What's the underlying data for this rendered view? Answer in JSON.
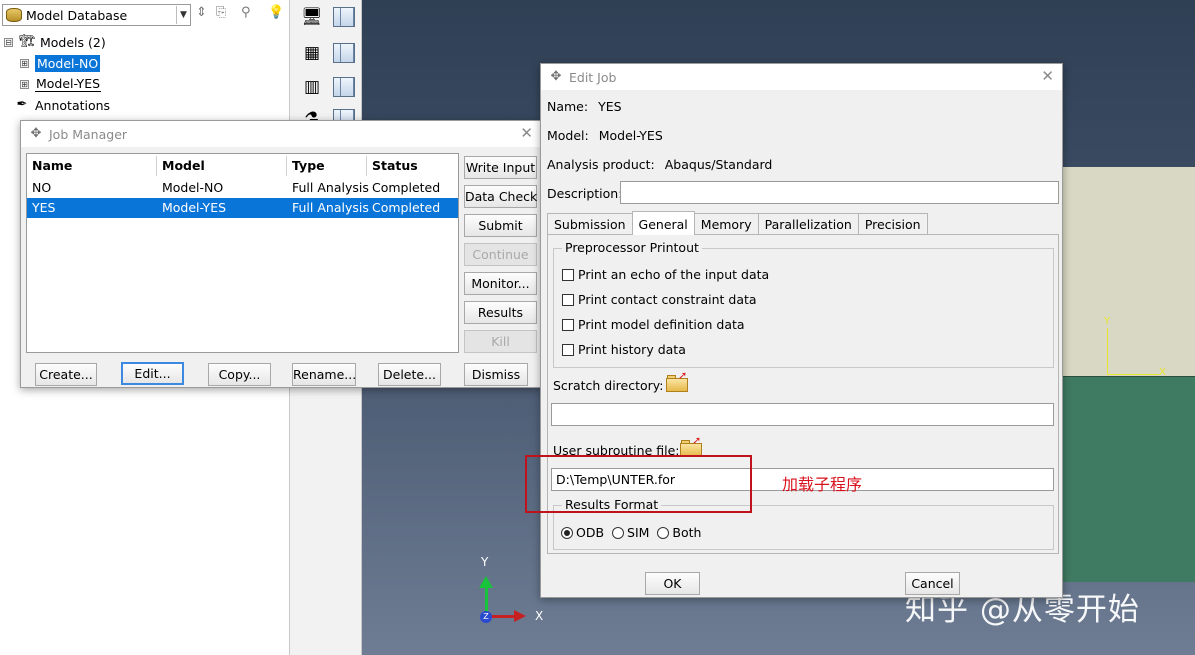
{
  "tree": {
    "db_selector": "Model Database",
    "items": [
      {
        "label": "Models (2)",
        "expander": "⊟"
      },
      {
        "label": "Model-NO",
        "expander": "⊞"
      },
      {
        "label": "Model-YES",
        "expander": "⊞"
      },
      {
        "label": "Annotations",
        "expander": ""
      }
    ]
  },
  "viewport": {
    "axis_x": "X",
    "axis_y": "Y",
    "local_x": "X",
    "local_y": "Y",
    "watermark": "知乎 @从零开始"
  },
  "job_manager": {
    "title": "Job Manager",
    "columns": [
      "Name",
      "Model",
      "Type",
      "Status"
    ],
    "rows": [
      {
        "name": "NO",
        "model": "Model-NO",
        "type": "Full Analysis",
        "status": "Completed"
      },
      {
        "name": "YES",
        "model": "Model-YES",
        "type": "Full Analysis",
        "status": "Completed"
      }
    ],
    "side_buttons": {
      "write_input": "Write Input",
      "data_check": "Data Check",
      "submit": "Submit",
      "continue": "Continue",
      "monitor": "Monitor...",
      "results": "Results",
      "kill": "Kill"
    },
    "bottom_buttons": {
      "create": "Create...",
      "edit": "Edit...",
      "copy": "Copy...",
      "rename": "Rename...",
      "delete": "Delete...",
      "dismiss": "Dismiss"
    }
  },
  "edit_job": {
    "title": "Edit Job",
    "name_label": "Name:",
    "name_value": "YES",
    "model_label": "Model:",
    "model_value": "Model-YES",
    "product_label": "Analysis product:",
    "product_value": "Abaqus/Standard",
    "description_label": "Description:",
    "description_value": "",
    "tabs": [
      "Submission",
      "General",
      "Memory",
      "Parallelization",
      "Precision"
    ],
    "active_tab": "General",
    "preprocessor": {
      "title": "Preprocessor Printout",
      "options": [
        {
          "label": "Print an echo of the input data",
          "checked": false
        },
        {
          "label": "Print contact constraint data",
          "checked": false
        },
        {
          "label": "Print model definition data",
          "checked": false
        },
        {
          "label": "Print history data",
          "checked": false
        }
      ]
    },
    "scratch_label": "Scratch directory:",
    "scratch_value": "",
    "subroutine_label": "User subroutine file:",
    "subroutine_value": "D:\\Temp\\UNTER.for",
    "results_format": {
      "title": "Results Format",
      "options": [
        "ODB",
        "SIM",
        "Both"
      ],
      "selected": "ODB"
    },
    "ok": "OK",
    "cancel": "Cancel"
  },
  "annotation": {
    "note": "加载子程序",
    "color": "#c0121c"
  }
}
